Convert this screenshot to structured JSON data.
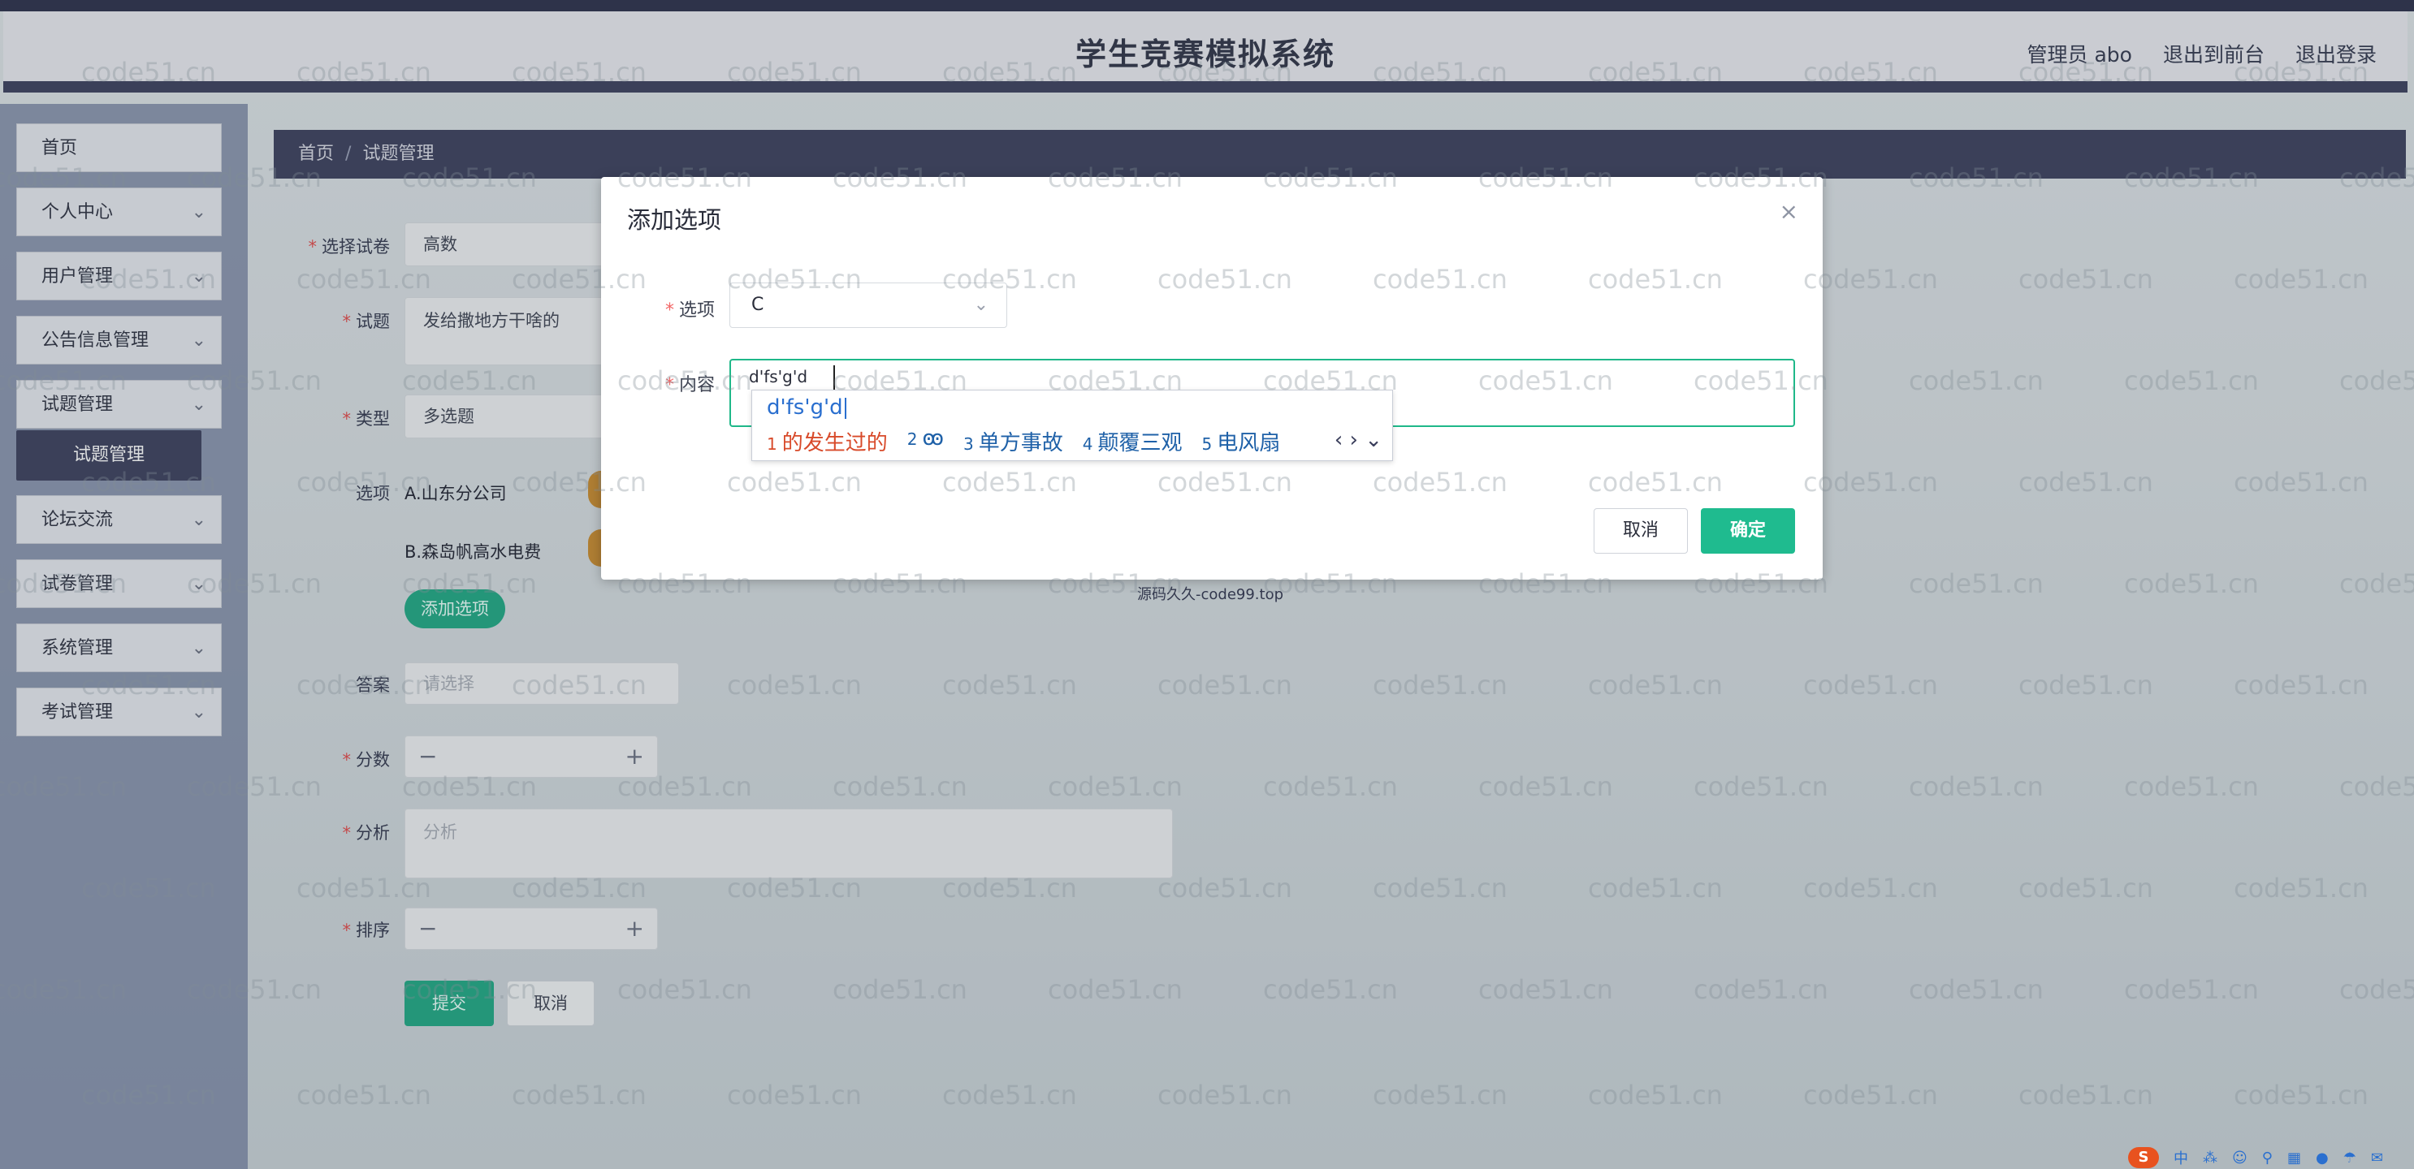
{
  "header": {
    "title": "学生竞赛模拟系统",
    "links": [
      "管理员 abo",
      "退出到前台",
      "退出登录"
    ]
  },
  "sidebar": {
    "items": [
      {
        "label": "首页"
      },
      {
        "label": "个人中心"
      },
      {
        "label": "用户管理"
      },
      {
        "label": "公告信息管理"
      },
      {
        "label": "试题管理"
      },
      {
        "label": "试题管理"
      },
      {
        "label": "论坛交流"
      },
      {
        "label": "试卷管理"
      },
      {
        "label": "系统管理"
      },
      {
        "label": "考试管理"
      }
    ]
  },
  "breadcrumb": {
    "home": "首页",
    "sep": "/",
    "current": "试题管理"
  },
  "form": {
    "paper_label": "选择试卷",
    "paper_value": "高数",
    "question_label": "试题",
    "question_value": "发给撒地方干啥的",
    "type_label": "类型",
    "type_value": "多选题",
    "options_label": "选项",
    "option_a": "A.山东分公司",
    "option_b": "B.森岛帆高水电费",
    "add_option": "添加选项",
    "answer_label": "答案",
    "answer_placeholder": "请选择",
    "score_label": "分数",
    "analysis_label": "分析",
    "analysis_placeholder": "分析",
    "order_label": "排序",
    "minus": "−",
    "plus": "+",
    "submit": "提交",
    "cancel": "取消"
  },
  "dialog": {
    "title": "添加选项",
    "close": "×",
    "option_label": "选项",
    "option_value": "C",
    "content_label": "内容",
    "content_value": "d'fs'g'd",
    "cancel": "取消",
    "ok": "确定"
  },
  "ime": {
    "composition": "d'fs'g'd",
    "candidates": [
      {
        "num": "1",
        "text": "的发生过的"
      },
      {
        "num": "2",
        "text": "ꙭ"
      },
      {
        "num": "3",
        "text": "单方事故"
      },
      {
        "num": "4",
        "text": "颠覆三观"
      },
      {
        "num": "5",
        "text": "电风扇"
      }
    ],
    "nav": "‹ › ⌄"
  },
  "footer": {
    "source": "源码久久-code99.top"
  },
  "watermark": "code51.cn",
  "tray": [
    "S",
    "中",
    "⁂",
    "☺",
    "⚲",
    "▦",
    "●",
    "☂",
    "✉"
  ],
  "colors": {
    "accent": "#1fbb8f",
    "nav": "#3b3f5c",
    "required": "#e24a4a"
  }
}
